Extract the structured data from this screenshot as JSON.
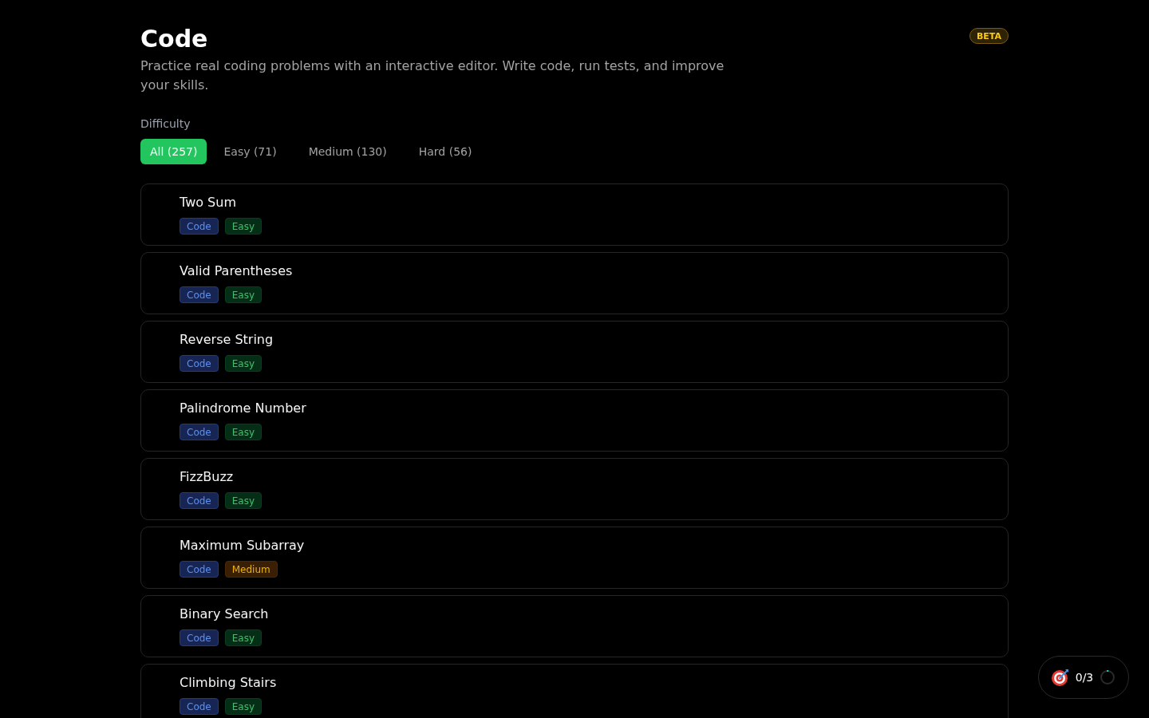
{
  "header": {
    "title": "Code",
    "badge": "BETA",
    "description": "Practice real coding problems with an interactive editor. Write code, run tests, and improve your skills."
  },
  "filter": {
    "label": "Difficulty",
    "tabs": [
      {
        "label": "All (257)",
        "selected": true
      },
      {
        "label": "Easy (71)",
        "selected": false
      },
      {
        "label": "Medium (130)",
        "selected": false
      },
      {
        "label": "Hard (56)",
        "selected": false
      }
    ]
  },
  "problems": [
    {
      "title": "Two Sum",
      "tags": [
        {
          "kind": "category",
          "label": "Code"
        },
        {
          "kind": "easy",
          "label": "Easy"
        }
      ]
    },
    {
      "title": "Valid Parentheses",
      "tags": [
        {
          "kind": "category",
          "label": "Code"
        },
        {
          "kind": "easy",
          "label": "Easy"
        }
      ]
    },
    {
      "title": "Reverse String",
      "tags": [
        {
          "kind": "category",
          "label": "Code"
        },
        {
          "kind": "easy",
          "label": "Easy"
        }
      ]
    },
    {
      "title": "Palindrome Number",
      "tags": [
        {
          "kind": "category",
          "label": "Code"
        },
        {
          "kind": "easy",
          "label": "Easy"
        }
      ]
    },
    {
      "title": "FizzBuzz",
      "tags": [
        {
          "kind": "category",
          "label": "Code"
        },
        {
          "kind": "easy",
          "label": "Easy"
        }
      ]
    },
    {
      "title": "Maximum Subarray",
      "tags": [
        {
          "kind": "category",
          "label": "Code"
        },
        {
          "kind": "medium",
          "label": "Medium"
        }
      ]
    },
    {
      "title": "Binary Search",
      "tags": [
        {
          "kind": "category",
          "label": "Code"
        },
        {
          "kind": "easy",
          "label": "Easy"
        }
      ]
    },
    {
      "title": "Climbing Stairs",
      "tags": [
        {
          "kind": "category",
          "label": "Code"
        },
        {
          "kind": "easy",
          "label": "Easy"
        }
      ]
    }
  ],
  "goal_widget": {
    "count": "0/3",
    "level": 0
  }
}
